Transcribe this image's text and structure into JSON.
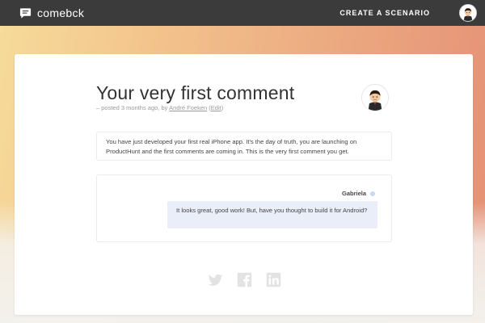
{
  "brand": {
    "name": "comebck"
  },
  "nav": {
    "create_label": "CREATE A SCENARIO"
  },
  "post": {
    "title": "Your very first comment",
    "meta_prefix": "– posted 3 months ago, by ",
    "author": "André Foeken",
    "edit_open": " (",
    "edit_label": "Edit",
    "edit_close": ")",
    "scenario": "You have just developed your first real iPhone app. It's the day of truth, you are launching on ProductHunt and the first comments are coming in. This is the very first comment you get."
  },
  "comment": {
    "sender": "Gabriela",
    "text": "It looks great, good work! But, have you thought to build it for Android?"
  },
  "icons": {
    "logo": "chat-bubble-icon",
    "avatar": "user-avatar",
    "share": [
      "twitter-icon",
      "facebook-icon",
      "linkedin-icon"
    ]
  },
  "colors": {
    "topbar": "#3b3b3b",
    "gradient_start": "#f6dc9b",
    "gradient_end": "#e58f76",
    "bubble": "#e9eef8",
    "share_icon": "#e3e3e3"
  }
}
